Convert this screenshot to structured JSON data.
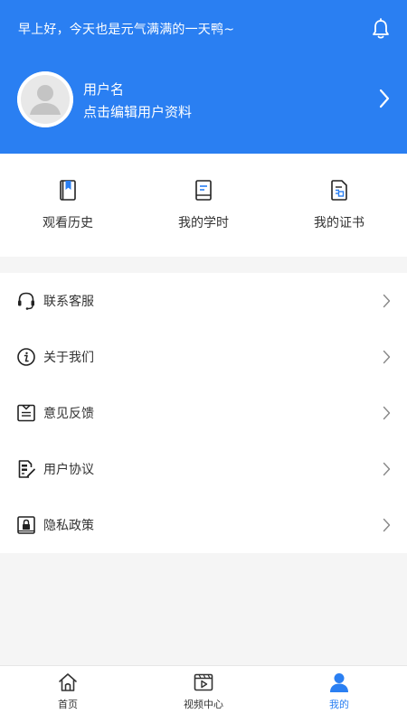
{
  "header": {
    "greeting": "早上好，今天也是元气满满的一天鸭~",
    "username": "用户名",
    "edit_hint": "点击编辑用户资料",
    "bell_icon": "bell-icon",
    "chevron_icon": "chevron-right-icon"
  },
  "quick_actions": [
    {
      "label": "观看历史",
      "icon": "bookmark-book-icon"
    },
    {
      "label": "我的学时",
      "icon": "document-icon"
    },
    {
      "label": "我的证书",
      "icon": "certificate-icon"
    }
  ],
  "menu": [
    {
      "label": "联系客服",
      "icon": "headset-icon"
    },
    {
      "label": "关于我们",
      "icon": "info-icon"
    },
    {
      "label": "意见反馈",
      "icon": "feedback-icon"
    },
    {
      "label": "用户协议",
      "icon": "agreement-icon"
    },
    {
      "label": "隐私政策",
      "icon": "privacy-lock-icon"
    }
  ],
  "tabbar": [
    {
      "label": "首页",
      "icon": "home-icon",
      "active": false
    },
    {
      "label": "视频中心",
      "icon": "video-icon",
      "active": false
    },
    {
      "label": "我的",
      "icon": "user-icon",
      "active": true
    }
  ],
  "colors": {
    "primary": "#2a7ff2",
    "text": "#333333",
    "background": "#f5f5f5",
    "icon_dark": "#222222",
    "icon_blue": "#2a7ff2"
  }
}
